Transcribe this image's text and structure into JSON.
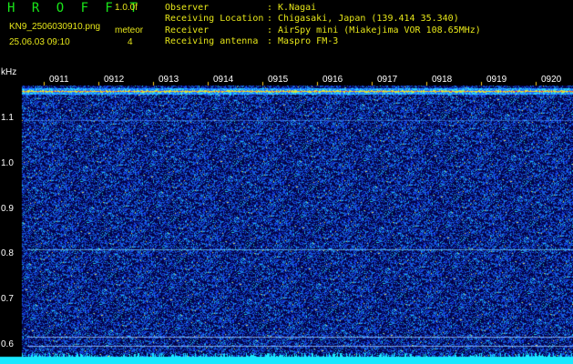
{
  "header": {
    "app_title": "H R O F F T",
    "version": "1.0.0f",
    "filename": "KN9_2506030910.png",
    "meteor_label": "meteor",
    "datetime": "25.06.03 09:10",
    "count": "4",
    "info": [
      {
        "key": "Observer",
        "value": ": K.Nagai"
      },
      {
        "key": "Receiving Location",
        "value": ": Chigasaki, Japan (139.414 35.340)"
      },
      {
        "key": "Receiver",
        "value": ": AirSpy mini (Miakejima VOR 108.65MHz)"
      },
      {
        "key": "Receiving antenna",
        "value": ": Maspro FM-3"
      }
    ]
  },
  "chart_data": {
    "type": "heatmap",
    "ylabel": "kHz",
    "y_ticks": [
      "1.1",
      "1.0",
      "0.9",
      "0.8",
      "0.7",
      "0.6"
    ],
    "x_ticks": [
      "0911",
      "0912",
      "0913",
      "0914",
      "0915",
      "0916",
      "0917",
      "0918",
      "0919",
      "0920"
    ],
    "ylim": [
      0.6,
      1.16
    ],
    "colors": {
      "background": "#04033a",
      "noise": "#1a3cc8",
      "signal": "#ffd020",
      "hot": "#ff3030",
      "baseline": "#18e8ff"
    }
  }
}
